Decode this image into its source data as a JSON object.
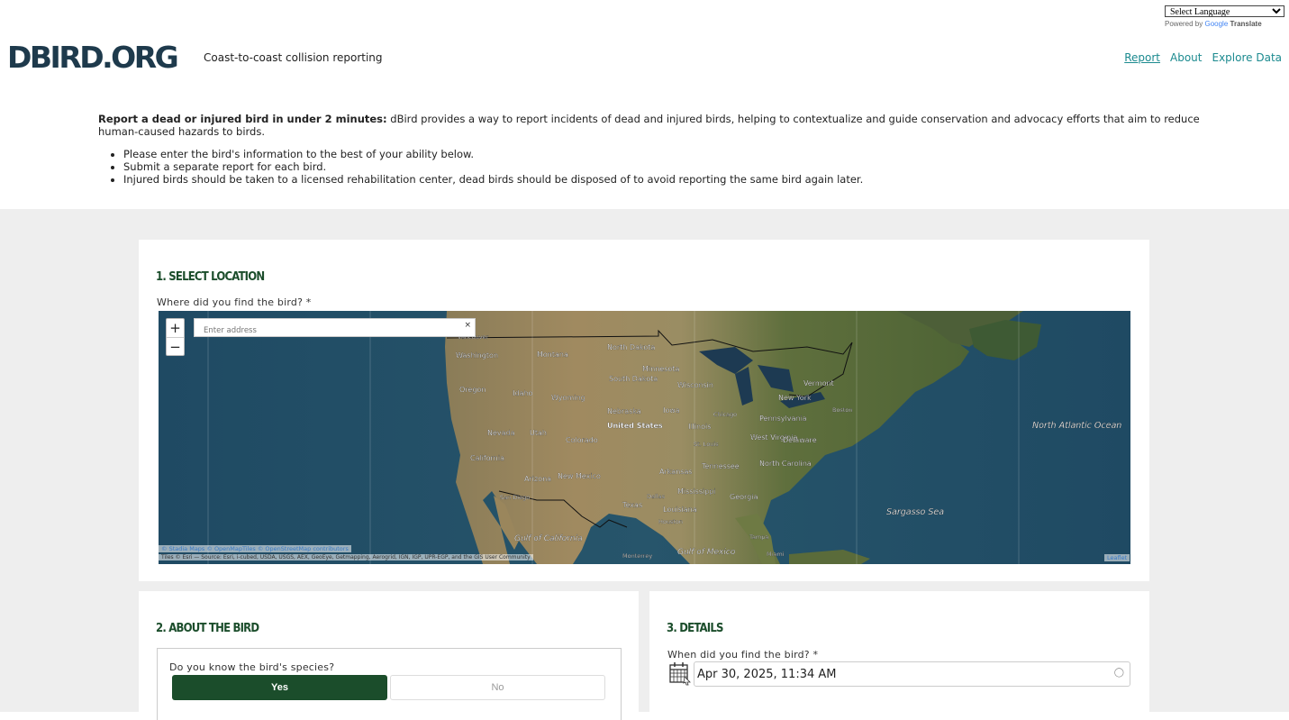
{
  "translate": {
    "select_label": "Select Language",
    "powered_by": "Powered by",
    "google": "Google",
    "translate": "Translate"
  },
  "header": {
    "logo": "DBIRD.ORG",
    "tagline": "Coast-to-coast collision reporting",
    "nav": [
      "Report",
      "About",
      "Explore Data"
    ],
    "active_nav": "Report"
  },
  "intro": {
    "lead_bold": "Report a dead or injured bird in under 2 minutes:",
    "lead_text": " dBird provides a way to report incidents of dead and injured birds, helping to contextualize and guide conservation and advocacy efforts that aim to reduce human-caused hazards to birds.",
    "bullets": [
      "Please enter the bird's information to the best of your ability below.",
      "Submit a separate report for each bird.",
      "Injured birds should be taken to a licensed rehabilitation center, dead birds should be disposed of to avoid reporting the same bird again later."
    ]
  },
  "location": {
    "title": "1. SELECT LOCATION",
    "question": "Where did you find the bird?  *",
    "address_placeholder": "Enter address",
    "zoom_in": "+",
    "zoom_out": "−",
    "clear": "×",
    "attribution1": "© Stadia Maps © OpenMapTiles © OpenStreetMap contributors",
    "attribution2": "Tiles © Esri — Source: Esri, i-cubed, USDA, USGS, AEX, GeoEye, Getmapping, Aerogrid, IGN, IGP, UPR-EGP, and the GIS User Community",
    "leaflet": "Leaflet",
    "map_labels": {
      "vancouver": "Vancouver",
      "washington": "Washington",
      "montana": "Montana",
      "north_dakota": "North Dakota",
      "minnesota": "Minnesota",
      "vermont": "Vermont",
      "oregon": "Oregon",
      "idaho": "Idaho",
      "south_dakota": "South Dakota",
      "wisconsin": "Wisconsin",
      "new_york": "New York",
      "wyoming": "Wyoming",
      "boston": "Boston",
      "nebraska": "Nebraska",
      "iowa": "Iowa",
      "chicago": "Chicago",
      "pennsylvania": "Pennsylvania",
      "united_states": "United States",
      "illinois": "Illinois",
      "nevada": "Nevada",
      "utah": "Utah",
      "colorado": "Colorado",
      "west_virginia": "West Virginia",
      "delaware": "Delaware",
      "st_louis": "St. Louis",
      "california": "California",
      "tennessee": "Tennessee",
      "north_carolina": "North Carolina",
      "arkansas": "Arkansas",
      "arizona": "Arizona",
      "new_mexico": "New Mexico",
      "mississippi": "Mississippi",
      "san_diego": "San Diego",
      "dallas": "Dallas",
      "georgia": "Georgia",
      "texas": "Texas",
      "louisiana": "Louisiana",
      "houston": "Houston",
      "gulf_california": "Gulf of California",
      "tampa": "Tampa",
      "monterrey": "Monterrey",
      "gulf_mexico": "Gulf of Mexico",
      "miami": "Miami",
      "north_atlantic": "North Atlantic Ocean",
      "sargasso": "Sargasso Sea"
    }
  },
  "bird": {
    "title": "2. ABOUT THE BIRD",
    "species_question": "Do you know the bird's species?",
    "yes": "Yes",
    "no": "No"
  },
  "details": {
    "title": "3. DETAILS",
    "when_question": "When did you find the bird?  *",
    "datetime_value": "Apr 30, 2025, 11:34 AM"
  }
}
